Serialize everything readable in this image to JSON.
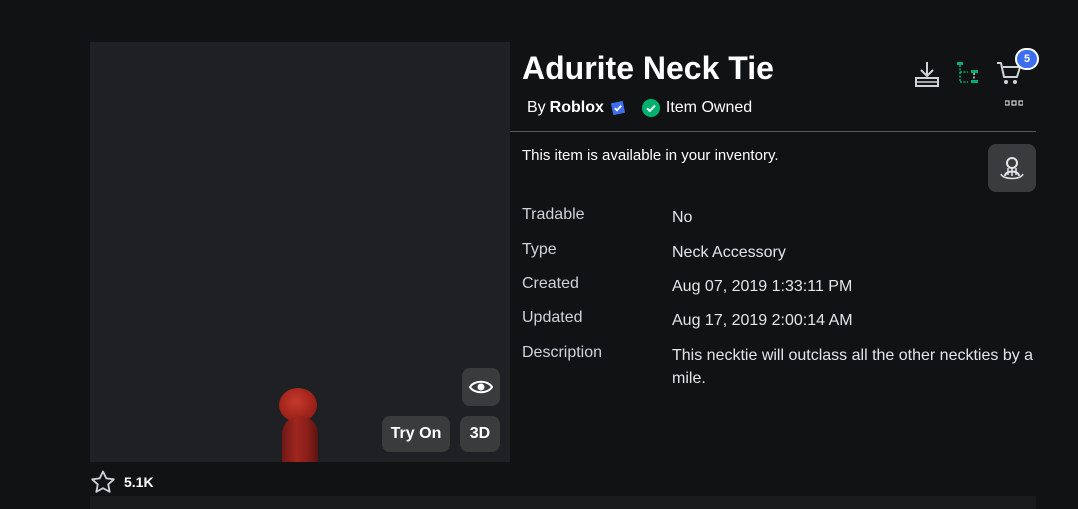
{
  "item": {
    "title": "Adurite Neck Tie",
    "by_prefix": "By",
    "creator": "Roblox",
    "owned_label": "Item Owned",
    "availability": "This item is available in your inventory."
  },
  "details": [
    {
      "key": "Tradable",
      "value": "No"
    },
    {
      "key": "Type",
      "value": "Neck Accessory"
    },
    {
      "key": "Created",
      "value": "Aug 07, 2019 1:33:11 PM"
    },
    {
      "key": "Updated",
      "value": "Aug 17, 2019 2:00:14 AM"
    },
    {
      "key": "Description",
      "value": "This necktie will outclass all the other neckties by a mile."
    }
  ],
  "viewer": {
    "try_on_label": "Try On",
    "three_d_label": "3D"
  },
  "favorites": {
    "count": "5.1K"
  },
  "cart": {
    "count": "5"
  },
  "colors": {
    "background": "#111214",
    "panel": "#1f2024",
    "button": "#393b3d",
    "verified_blue": "#3d6ef0",
    "owned_green": "#00b06f",
    "cart_badge": "#3d6ef0"
  },
  "icons": [
    "download-icon",
    "hierarchy-icon",
    "cart-icon",
    "more-icon",
    "verified-icon",
    "check-circle-icon",
    "eye-icon",
    "try-on-icon",
    "star-icon"
  ]
}
